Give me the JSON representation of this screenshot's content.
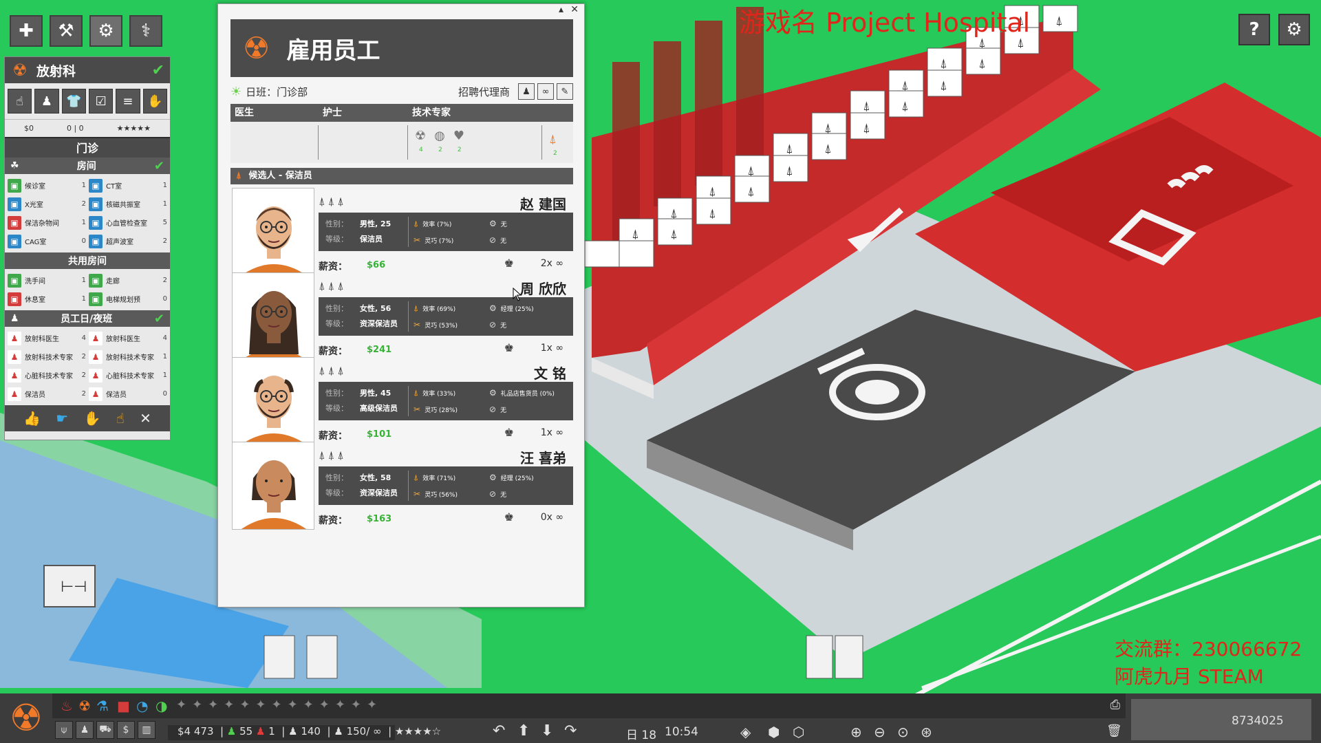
{
  "overlay": {
    "title": "游戏名 Project Hospital",
    "group": "交流群：230066672",
    "streamer": "阿虎九月 STEAM"
  },
  "top_tools": [
    "plus-icon",
    "hammer-icon",
    "gear-icon",
    "stethoscope-icon"
  ],
  "left_panel": {
    "department": "放射科",
    "stats": {
      "money": "$0",
      "staff": "0 | 0",
      "rating": "★★★★★"
    },
    "section": "门诊",
    "rooms_title": "房间",
    "rooms": [
      {
        "label": "候诊室",
        "count": "1",
        "color": "#3fa84a"
      },
      {
        "label": "CT室",
        "count": "1",
        "color": "#2c87c9"
      },
      {
        "label": "X光室",
        "count": "2",
        "color": "#2c87c9"
      },
      {
        "label": "核磁共振室",
        "count": "1",
        "color": "#2c87c9"
      },
      {
        "label": "保洁杂物间",
        "count": "1",
        "color": "#d43b3b"
      },
      {
        "label": "心血管检查室",
        "count": "5",
        "color": "#2c87c9"
      },
      {
        "label": "CAG室",
        "count": "0",
        "color": "#2c87c9"
      },
      {
        "label": "超声波室",
        "count": "2",
        "color": "#2c87c9"
      }
    ],
    "shared_title": "共用房间",
    "shared_rooms": [
      {
        "label": "洗手间",
        "count": "1",
        "color": "#3fa84a"
      },
      {
        "label": "走廊",
        "count": "2",
        "color": "#3fa84a"
      },
      {
        "label": "休息室",
        "count": "1",
        "color": "#d43b3b"
      },
      {
        "label": "电梯规划预",
        "count": "0",
        "color": "#3fa84a"
      }
    ],
    "staff_title": "员工日/夜班",
    "staff": [
      {
        "label": "放射科医生",
        "count": "4"
      },
      {
        "label": "放射科医生",
        "count": "4"
      },
      {
        "label": "放射科技术专家",
        "count": "2"
      },
      {
        "label": "放射科技术专家",
        "count": "1"
      },
      {
        "label": "心脏科技术专家",
        "count": "2"
      },
      {
        "label": "心脏科技术专家",
        "count": "1"
      },
      {
        "label": "保洁员",
        "count": "2"
      },
      {
        "label": "保洁员",
        "count": "0"
      }
    ]
  },
  "hire": {
    "title": "雇用员工",
    "shift": "日班：门诊部",
    "agency": "招聘代理商",
    "tabs": [
      "医生",
      "护士",
      "技术专家"
    ],
    "spec_counts": [
      "4",
      "2",
      "2"
    ],
    "janitor_count": "2",
    "candidates_title": "候选人 - 保洁员",
    "labels": {
      "gender": "性别：",
      "level": "等级：",
      "salary": "薪资："
    },
    "candidates": [
      {
        "name": "赵 建国",
        "gender_age": "男性, 25",
        "level": "保洁员",
        "skill1": "效率 (7%)",
        "skill2": "灵巧 (7%)",
        "trait1": "无",
        "trait2": "无",
        "salary": "$66",
        "mult": "2x ∞",
        "portrait": "male-beard-glasses"
      },
      {
        "name": "周 欣欣",
        "gender_age": "女性, 56",
        "level": "资深保洁员",
        "skill1": "效率 (69%)",
        "skill2": "灵巧 (53%)",
        "trait1": "经理 (25%)",
        "trait2": "无",
        "salary": "$241",
        "mult": "1x ∞",
        "portrait": "female-long-hair-glasses"
      },
      {
        "name": "文 铭",
        "gender_age": "男性, 45",
        "level": "高级保洁员",
        "skill1": "效率 (33%)",
        "skill2": "灵巧 (28%)",
        "trait1": "礼品店售货员 (0%)",
        "trait2": "无",
        "salary": "$101",
        "mult": "1x ∞",
        "portrait": "male-bald-beard-glasses"
      },
      {
        "name": "汪 喜弟",
        "gender_age": "女性, 58",
        "level": "资深保洁员",
        "skill1": "效率 (71%)",
        "skill2": "灵巧 (56%)",
        "trait1": "经理 (25%)",
        "trait2": "无",
        "salary": "$163",
        "mult": "0x ∞",
        "portrait": "female-short-hair"
      }
    ]
  },
  "bottom": {
    "money": "$4 473",
    "patients": "55",
    "patients2": "1",
    "staff": "140",
    "capacity": "150/ ∞",
    "rating": "★★★★☆",
    "day": "日 18",
    "time": "10:54",
    "score": "8734025"
  },
  "colors": {
    "accent": "#f07a2a",
    "green": "#35b335",
    "panel": "#4b4b4b"
  }
}
